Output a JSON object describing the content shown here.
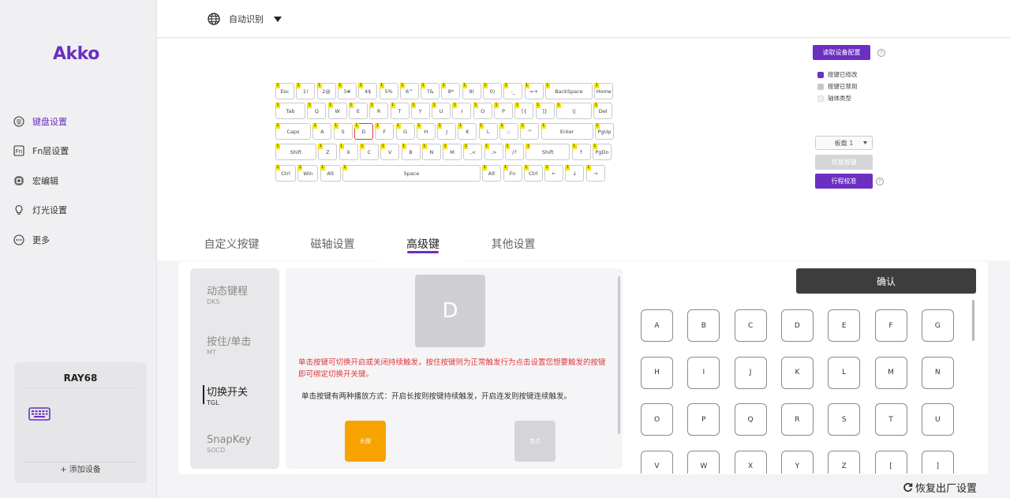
{
  "brand": "Akko",
  "colors": {
    "accent": "#6b2fc2",
    "layer_marker": "#f4e400",
    "modified": "#6b2fc2",
    "disabled": "#c8c8cc",
    "alert": "#e0393e",
    "hold": "#f7a400"
  },
  "sidebar": {
    "items": [
      {
        "label": "键盘设置",
        "icon": "keyboard-grid-icon",
        "active": true
      },
      {
        "label": "Fn层设置",
        "icon": "fn-icon"
      },
      {
        "label": "宏编辑",
        "icon": "chip-icon"
      },
      {
        "label": "灯光设置",
        "icon": "bulb-icon"
      },
      {
        "label": "更多",
        "icon": "more-icon"
      }
    ],
    "device": {
      "name": "RAY68",
      "icon": "keyboard-icon",
      "add_label": "+ 添加设备"
    }
  },
  "topbar": {
    "language": "自动识别",
    "globe_icon": "globe-icon"
  },
  "keyboard": {
    "layer_marker": "1",
    "rows": [
      [
        "Esc",
        "1!",
        "2@",
        "3#",
        "4$",
        "5%",
        "6^",
        "7&",
        "8*",
        "9(",
        "0)",
        "-_",
        "=+",
        "BackSpace",
        "Home"
      ],
      [
        "Tab",
        "Q",
        "W",
        "E",
        "R",
        "T",
        "Y",
        "U",
        "I",
        "O",
        "P",
        "[{",
        "]}",
        "\\|",
        "Del"
      ],
      [
        "Caps",
        "A",
        "S",
        "D",
        "F",
        "G",
        "H",
        "J",
        "K",
        "L",
        ";:",
        "'\"",
        "Enter",
        "PgUp"
      ],
      [
        "Shift",
        "Z",
        "X",
        "C",
        "V",
        "B",
        "N",
        "M",
        ",<",
        ".>",
        "/?",
        "Shift",
        "↑",
        "PgDn"
      ],
      [
        "Ctrl",
        "Win",
        "Alt",
        "Space",
        "Alt",
        "Fn",
        "Ctrl",
        "←",
        "↓",
        "→"
      ]
    ],
    "selected_key": "D"
  },
  "config": {
    "read_button": "读取设备配置",
    "legend": [
      {
        "label": "按键已修改",
        "color": "#6b2fc2"
      },
      {
        "label": "按键已禁用",
        "color": "#c8c8cc"
      },
      {
        "label": "轴体类型",
        "color": "#eeeeee"
      }
    ],
    "layer_select": "板载 1",
    "restore_button": "恢复按键",
    "calibrate_button": "行程校准"
  },
  "tabs": [
    {
      "label": "自定义按键"
    },
    {
      "label": "磁轴设置"
    },
    {
      "label": "高级键",
      "active": true
    },
    {
      "label": "其他设置"
    }
  ],
  "advanced": {
    "modes": [
      {
        "title": "动态键程",
        "code": "DKS"
      },
      {
        "title": "按住/单击",
        "code": "MT"
      },
      {
        "title": "切换开关",
        "code": "TGL",
        "active": true
      },
      {
        "title": "SnapKey",
        "code": "SOCD"
      }
    ],
    "key_label": "D",
    "warning": "单击按键可切换开启或关闭持续触发，按住按键则为正常触发行为点击设置您想要触发的按键即可绑定切换开关键。",
    "info": "单击按键有两种播放方式：开启长按则按键持续触发，开启连发则按键连续触发。",
    "hold_button": "长按",
    "repeat_button": "连点"
  },
  "keypicker": {
    "confirm": "确认",
    "keys": [
      "A",
      "B",
      "C",
      "D",
      "E",
      "F",
      "G",
      "H",
      "I",
      "J",
      "K",
      "L",
      "M",
      "N",
      "O",
      "P",
      "Q",
      "R",
      "S",
      "T",
      "U",
      "V",
      "W",
      "X",
      "Y",
      "Z",
      "[",
      "]"
    ]
  },
  "footer": {
    "reset_label": "恢复出厂设置",
    "reset_icon": "refresh-icon"
  }
}
